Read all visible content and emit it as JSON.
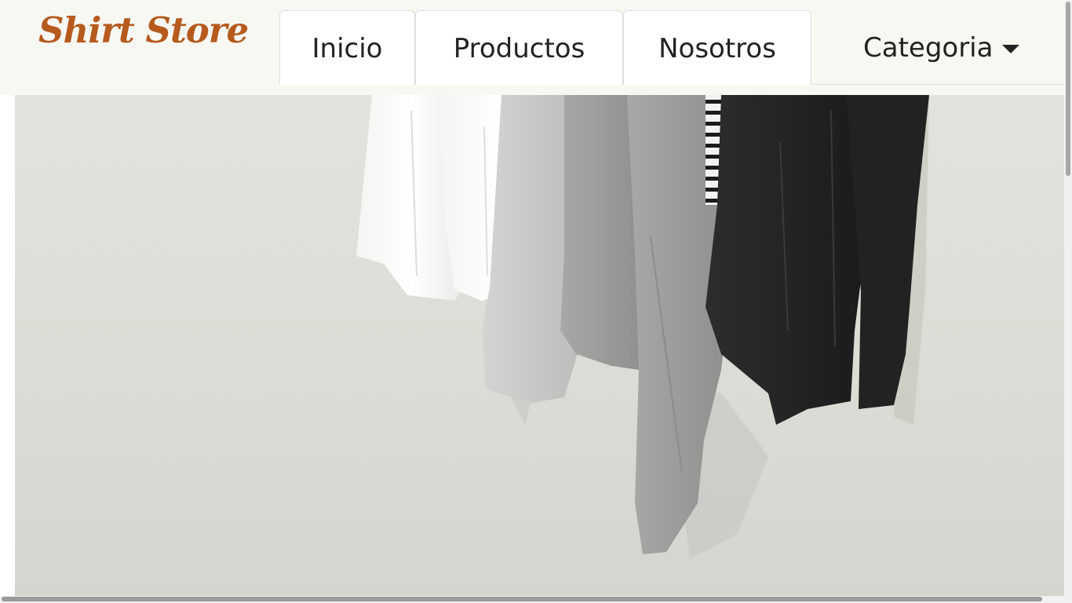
{
  "brand": {
    "name": "Shirt Store",
    "color": "#b65a1d"
  },
  "nav": {
    "tabs": [
      {
        "label": "Inicio"
      },
      {
        "label": "Productos"
      },
      {
        "label": "Nosotros"
      }
    ],
    "dropdown": {
      "label": "Categoria",
      "icon": "caret-down-icon"
    }
  },
  "hero": {
    "image": "photo of t-shirts hanging on a rail against a light wall",
    "shirt_colors": [
      "#ffffff",
      "#f1f1ef",
      "#c8c8c6",
      "#9e9e9c",
      "#2a2828",
      "#1e1c1c"
    ]
  }
}
